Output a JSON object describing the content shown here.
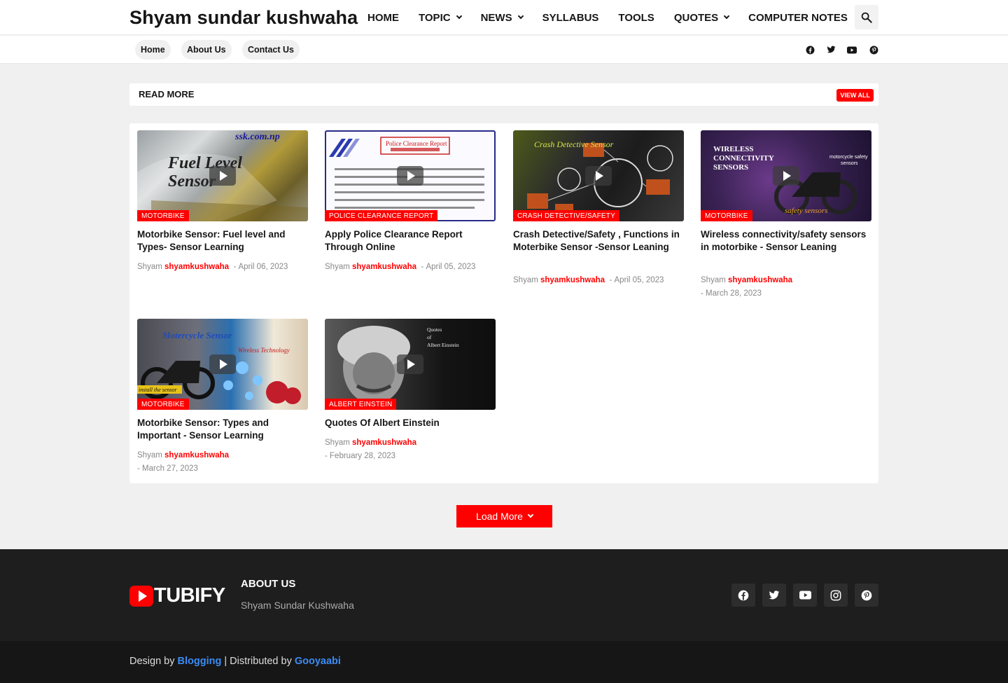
{
  "header": {
    "brand": "Shyam sundar kushwaha",
    "nav": [
      {
        "label": "HOME",
        "dropdown": false
      },
      {
        "label": "TOPIC",
        "dropdown": true
      },
      {
        "label": "NEWS",
        "dropdown": true
      },
      {
        "label": "SYLLABUS",
        "dropdown": false
      },
      {
        "label": "TOOLS",
        "dropdown": false
      },
      {
        "label": "QUOTES",
        "dropdown": true
      },
      {
        "label": "COMPUTER NOTES",
        "dropdown": false
      }
    ],
    "search_icon": "search-icon"
  },
  "subnav": {
    "pills": [
      "Home",
      "About Us",
      "Contact Us"
    ],
    "social_icons": [
      "facebook-icon",
      "twitter-icon",
      "youtube-icon",
      "pinterest-icon"
    ]
  },
  "section": {
    "title": "READ MORE",
    "view_all": "VIEW ALL"
  },
  "posts": [
    {
      "tag": "MOTORBIKE",
      "title": "Motorbike Sensor: Fuel level and Types- Sensor Learning",
      "author_first": "Shyam",
      "author": "shyamkushwaha",
      "date": "April 06, 2023",
      "thumb_text": "ssk.com.np"
    },
    {
      "tag": "POLICE CLEARANCE REPORT",
      "title": "Apply Police Clearance Report Through Online",
      "author_first": "Shyam",
      "author": "shyamkushwaha",
      "date": "April 05, 2023",
      "thumb_text": "Police Clearance Report"
    },
    {
      "tag": "CRASH DETECTIVE/SAFETY",
      "title": "Crash Detective/Safety , Functions in Moterbike Sensor -Sensor Leaning",
      "author_first": "Shyam",
      "author": "shyamkushwaha",
      "date": "April 05, 2023",
      "thumb_text": "Crash Detective Sensor"
    },
    {
      "tag": "MOTORBIKE",
      "title": "Wireless connectivity/safety sensors in motorbike - Sensor Leaning",
      "author_first": "Shyam",
      "author": "shyamkushwaha",
      "date": "March 28, 2023",
      "thumb_text": "WIRELESS CONNECTIVITY SENSORS"
    },
    {
      "tag": "MOTORBIKE",
      "title": "Motorbike Sensor: Types and Important - Sensor Learning",
      "author_first": "Shyam",
      "author": "shyamkushwaha",
      "date": "March 27, 2023",
      "thumb_text": "Motercycle Sensor"
    },
    {
      "tag": "ALBERT EINSTEIN",
      "title": "Quotes Of Albert Einstein",
      "author_first": "Shyam",
      "author": "shyamkushwaha",
      "date": "February 28, 2023",
      "thumb_text": "Quotes of Albert Einstein"
    }
  ],
  "load_more": "Load More",
  "footer": {
    "logo_text": "TUBIFY",
    "about_title": "ABOUT US",
    "about_text": "Shyam Sundar Kushwaha",
    "social_icons": [
      "facebook-icon",
      "twitter-icon",
      "youtube-icon",
      "instagram-icon",
      "pinterest-icon"
    ],
    "credits": {
      "design_by": "Design by",
      "design_link": "Blogging",
      "separator": "| Distributed by",
      "dist_link": "Gooyaabi"
    }
  },
  "colors": {
    "accent": "#ff0000",
    "link_blue": "#3b8cf5",
    "footer_bg": "#1e1e1e",
    "bottom_bg": "#161616"
  }
}
